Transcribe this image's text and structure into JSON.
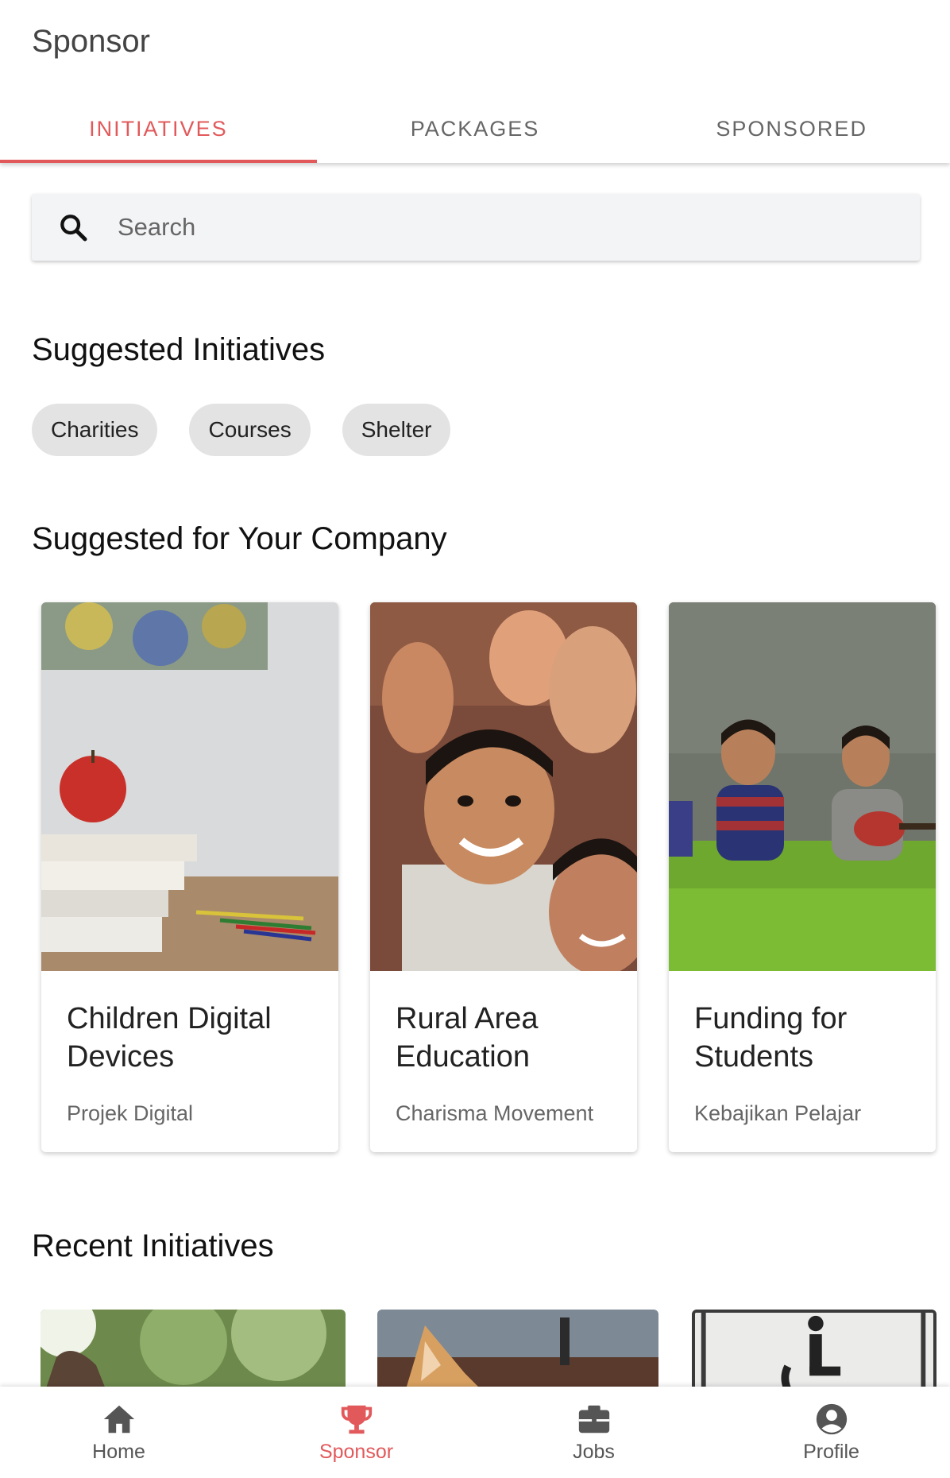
{
  "app": {
    "title": "Sponsor"
  },
  "tabs": [
    {
      "label": "INITIATIVES",
      "active": true
    },
    {
      "label": "PACKAGES",
      "active": false
    },
    {
      "label": "SPONSORED",
      "active": false
    }
  ],
  "search": {
    "placeholder": "Search",
    "value": "",
    "icon": "search-icon"
  },
  "suggested_initiatives": {
    "title": "Suggested Initiatives",
    "chips": [
      "Charities",
      "Courses",
      "Shelter"
    ]
  },
  "suggested_company": {
    "title": "Suggested for Your Company",
    "cards": [
      {
        "title": "Children Digital Devices",
        "org": "Projek Digital",
        "image": "books-apple-photo"
      },
      {
        "title": "Rural Area Education",
        "org": "Charisma Movement",
        "image": "children-smiling-photo"
      },
      {
        "title": "Funding for Students",
        "org": "Kebajikan Pelajar",
        "image": "children-grass-photo"
      }
    ]
  },
  "recent_initiatives": {
    "title": "Recent Initiatives",
    "cards": [
      {
        "image": "animal-outdoor-photo"
      },
      {
        "image": "cat-photo"
      },
      {
        "image": "wheelchair-sign-photo"
      }
    ]
  },
  "bottom_nav": [
    {
      "label": "Home",
      "icon": "home-icon",
      "active": false
    },
    {
      "label": "Sponsor",
      "icon": "trophy-icon",
      "active": true
    },
    {
      "label": "Jobs",
      "icon": "briefcase-icon",
      "active": false
    },
    {
      "label": "Profile",
      "icon": "profile-icon",
      "active": false
    }
  ],
  "colors": {
    "accent": "#e2595b",
    "chip_bg": "#e3e3e3",
    "search_bg": "#f3f4f6"
  }
}
